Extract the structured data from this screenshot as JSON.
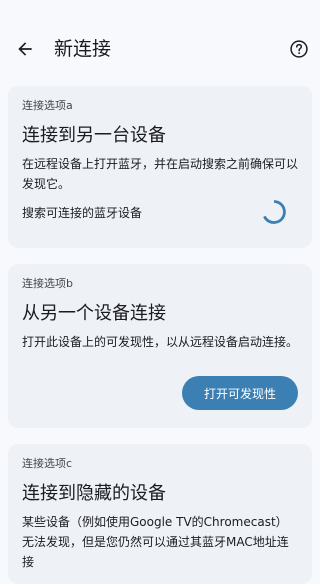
{
  "header": {
    "title": "新连接",
    "back_icon": "arrow-back-icon",
    "help_icon": "help-circle-icon"
  },
  "cards": [
    {
      "subtitle": "连接选项a",
      "heading": "连接到另一台设备",
      "description": "在远程设备上打开蓝牙，并在启动搜索之前确保可以发现它。",
      "search_label": "搜索可连接的蓝牙设备"
    },
    {
      "subtitle": "连接选项b",
      "heading": "从另一个设备连接",
      "description": "打开此设备上的可发现性，以从远程设备启动连接。",
      "button_label": "打开可发现性"
    },
    {
      "subtitle": "连接选项c",
      "heading": "连接到隐藏的设备",
      "description": "某些设备（例如使用Google TV的Chromecast）无法发现，但是您仍然可以通过其蓝牙MAC地址连接"
    }
  ],
  "colors": {
    "accent": "#3b7fb3",
    "card_background": "#eef1f6",
    "page_background": "#f7f9fc"
  }
}
